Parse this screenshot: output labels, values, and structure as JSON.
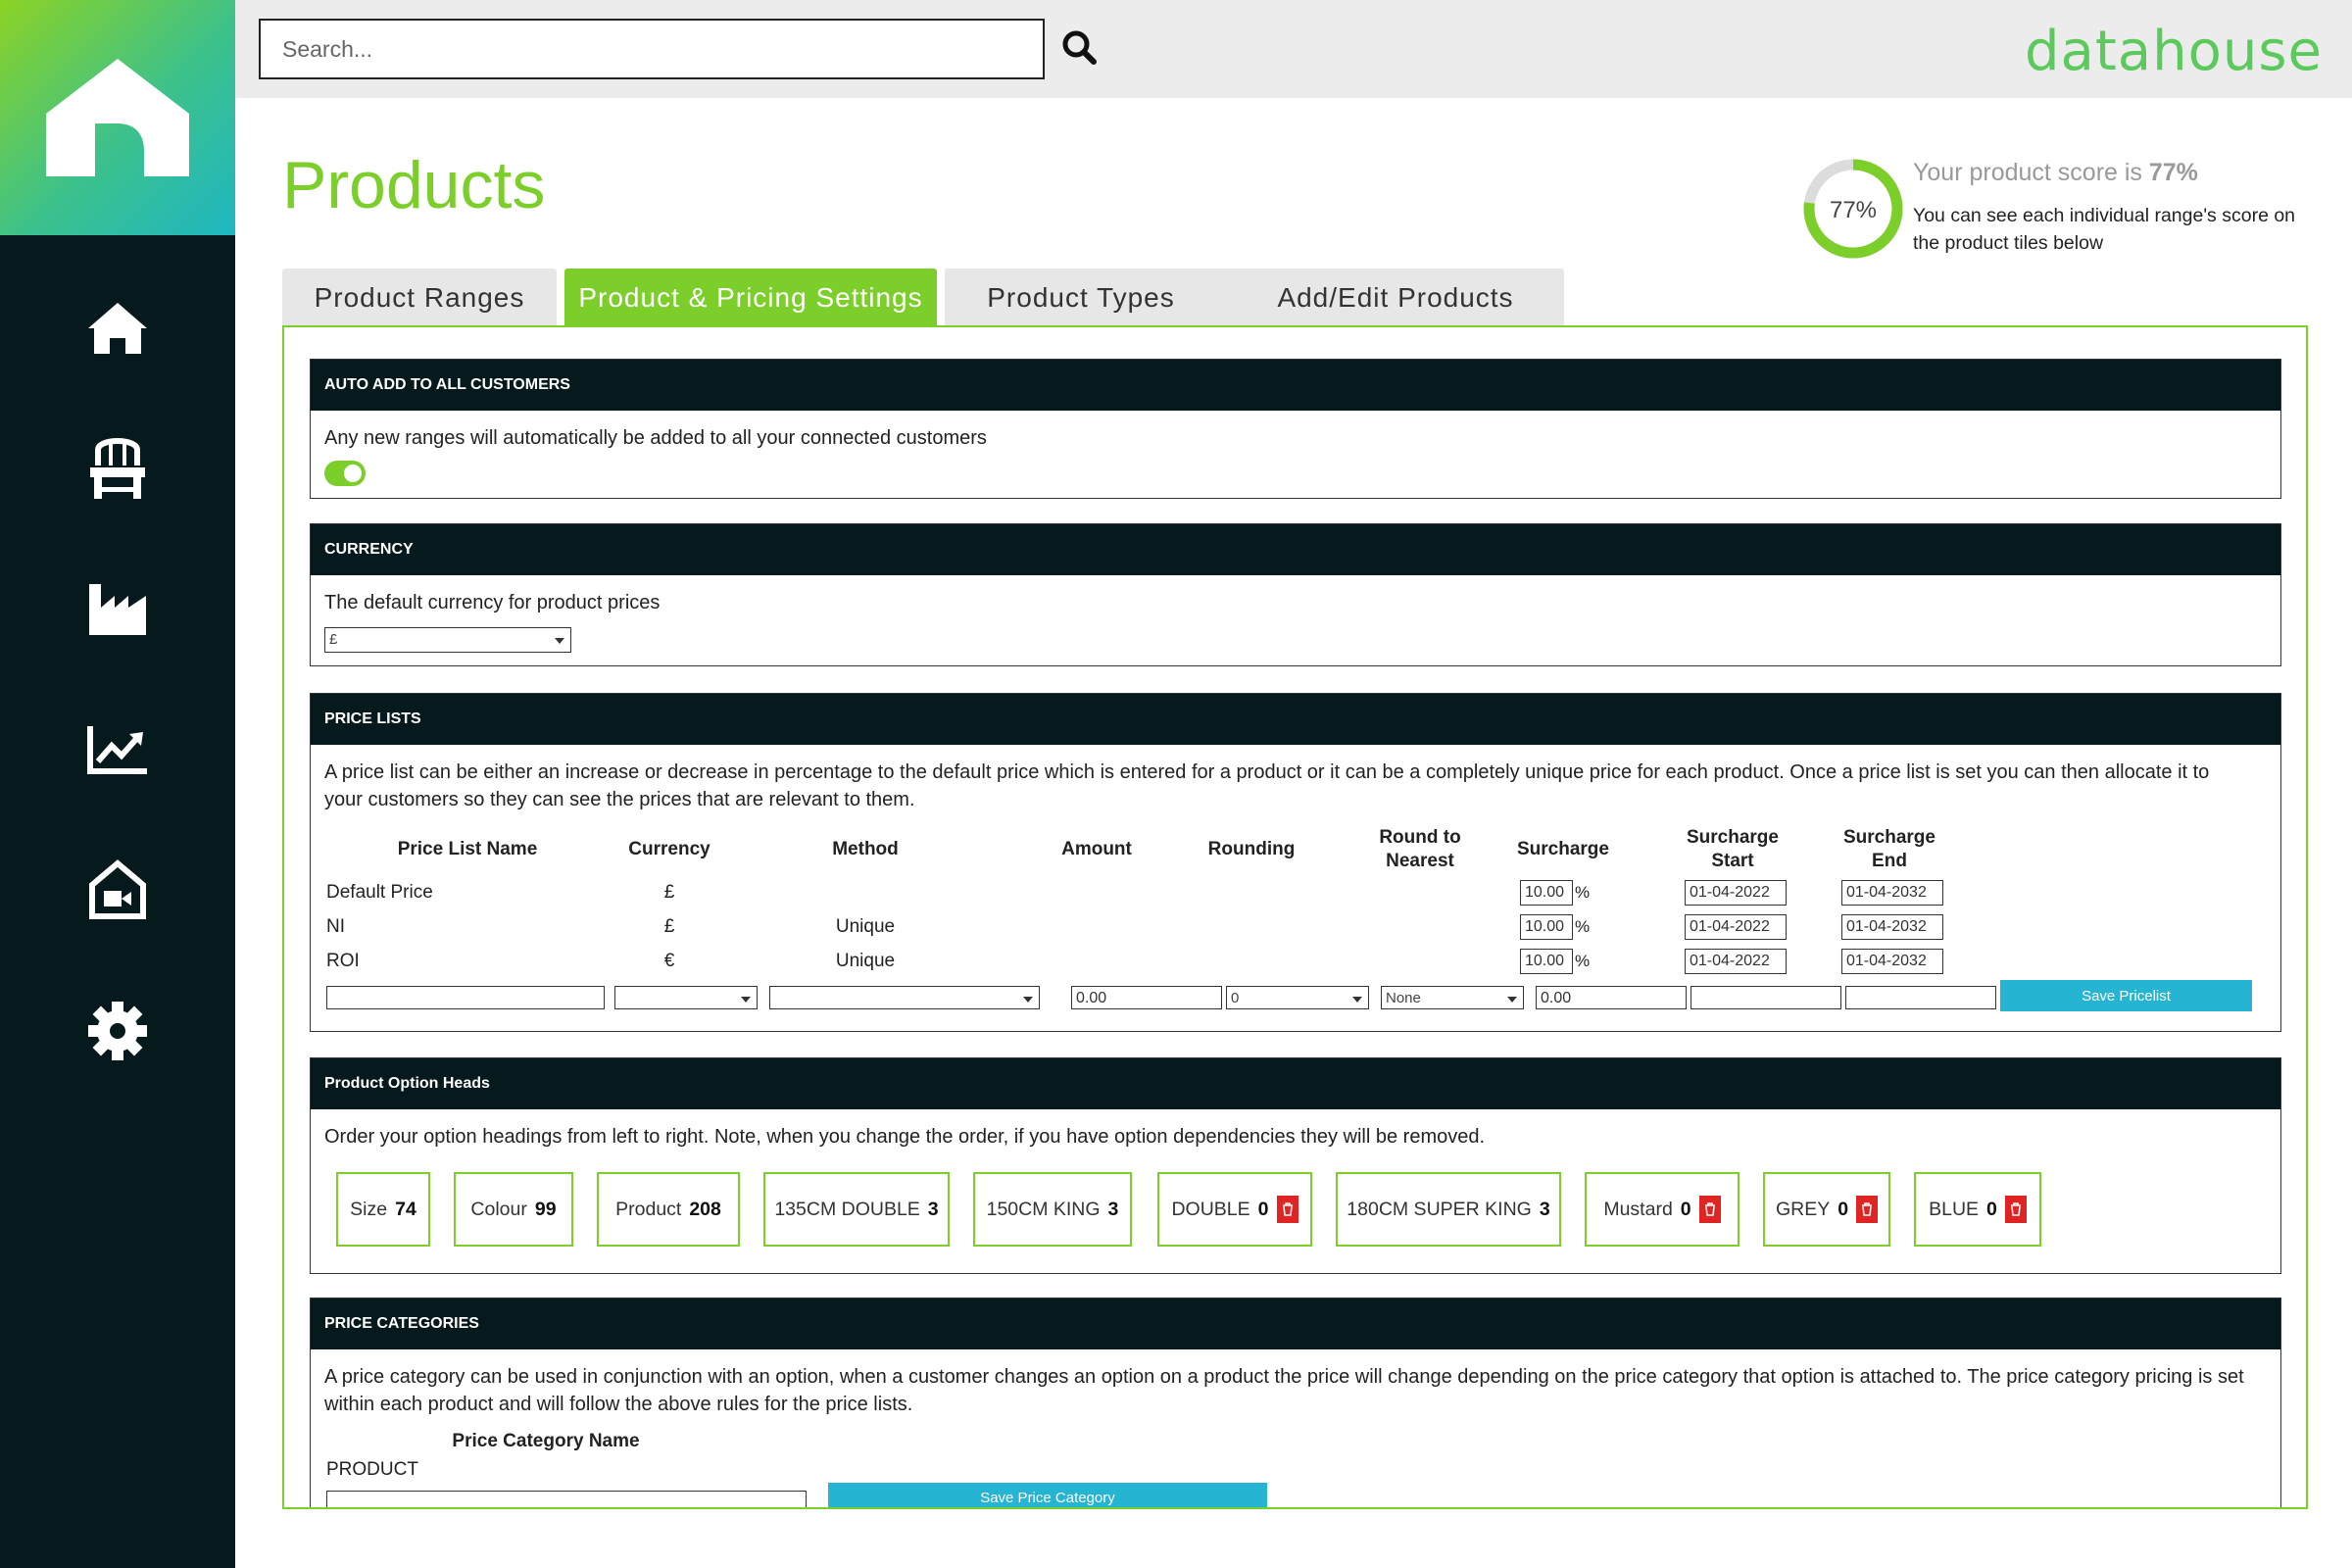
{
  "sidebar": {
    "items": [
      {
        "icon": "home-icon"
      },
      {
        "icon": "chair-icon"
      },
      {
        "icon": "factory-icon"
      },
      {
        "icon": "trending-chart-icon"
      },
      {
        "icon": "showroom-video-icon"
      },
      {
        "icon": "gear-icon"
      }
    ]
  },
  "header": {
    "search_placeholder": "Search...",
    "brand": "datahouse"
  },
  "page": {
    "title": "Products",
    "score": {
      "ring_value": "77%",
      "percent": 77,
      "head_prefix": "Your product score is ",
      "head_value": "77%",
      "sub": "You can see each individual range's score on the product tiles below"
    }
  },
  "tabs": [
    {
      "label": "Product Ranges"
    },
    {
      "label": "Product & Pricing Settings",
      "active": true
    },
    {
      "label": "Product Types"
    },
    {
      "label": "Add/Edit Products"
    }
  ],
  "sections": {
    "auto_add": {
      "title": "AUTO ADD TO ALL CUSTOMERS",
      "desc": "Any new ranges will automatically be added to all your connected customers",
      "enabled": true
    },
    "currency": {
      "title": "CURRENCY",
      "desc": "The default currency for product prices",
      "value": "£"
    },
    "price_lists": {
      "title": "PRICE LISTS",
      "desc": "A price list can be either an increase or decrease in percentage to the default price which is entered for a product or it can be a completely unique price for each product. Once a price list is set you can then allocate it to your customers so they can see the prices that are relevant to them.",
      "headers": [
        "Price List Name",
        "Currency",
        "Method",
        "Amount",
        "Rounding",
        "Round to Nearest",
        "Surcharge",
        "Surcharge Start",
        "Surcharge End"
      ],
      "rows": [
        {
          "name": "Default Price",
          "currency": "£",
          "method": "",
          "surcharge": "10.00",
          "start": "01-04-2022",
          "end": "01-04-2032"
        },
        {
          "name": "NI",
          "currency": "£",
          "method": "Unique",
          "surcharge": "10.00",
          "start": "01-04-2022",
          "end": "01-04-2032"
        },
        {
          "name": "ROI",
          "currency": "€",
          "method": "Unique",
          "surcharge": "10.00",
          "start": "01-04-2022",
          "end": "01-04-2032"
        }
      ],
      "pct_symbol": "%",
      "new_row": {
        "amount": "0.00",
        "rounding": "0",
        "round_to": "None",
        "surcharge": "0.00"
      },
      "save_label": "Save Pricelist"
    },
    "option_heads": {
      "title": "Product Option Heads",
      "desc": "Order your option headings from left to right. Note, when you change the order, if you have option dependencies they will be removed.",
      "chips": [
        {
          "label": "Size",
          "count": "74"
        },
        {
          "label": "Colour",
          "count": "99"
        },
        {
          "label": "Product",
          "count": "208"
        },
        {
          "label": "135CM DOUBLE",
          "count": "3"
        },
        {
          "label": "150CM KING",
          "count": "3"
        },
        {
          "label": "DOUBLE",
          "count": "0"
        },
        {
          "label": "180CM SUPER KING",
          "count": "3"
        },
        {
          "label": "Mustard",
          "count": "0"
        },
        {
          "label": "GREY",
          "count": "0"
        },
        {
          "label": "BLUE",
          "count": "0"
        }
      ]
    },
    "price_categories": {
      "title": "PRICE CATEGORIES",
      "desc": "A price category can be used in conjunction with an option, when a customer changes an option on a product the price will change depending on the price category that option is attached to. The price category pricing is set within each product and will follow the above rules for the price lists.",
      "header": "Price Category Name",
      "rows": [
        "PRODUCT"
      ],
      "save_label": "Save Price Category"
    }
  }
}
